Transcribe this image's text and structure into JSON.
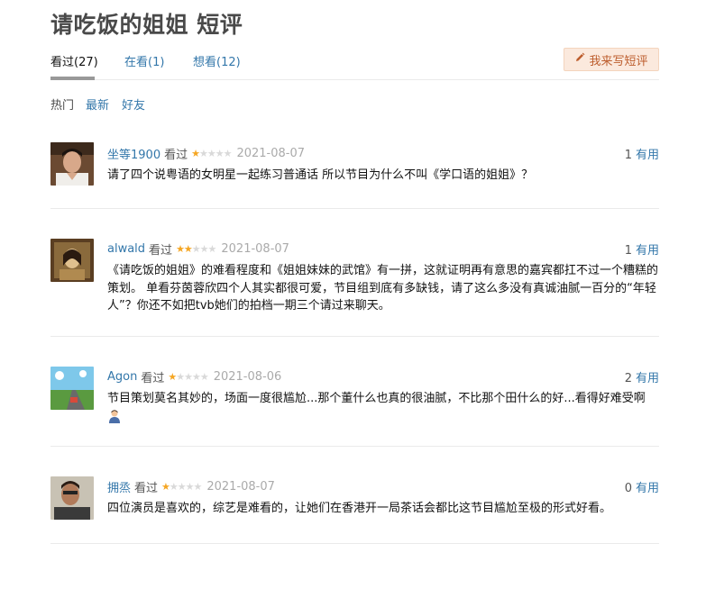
{
  "page": {
    "title": "请吃饭的姐姐 短评"
  },
  "tabs": [
    {
      "label": "看过(27)"
    },
    {
      "label": "在看(1)"
    },
    {
      "label": "想看(12)"
    }
  ],
  "write_button": {
    "label": "我来写短评",
    "icon": "pencil-icon"
  },
  "sorts": [
    {
      "label": "热门"
    },
    {
      "label": "最新"
    },
    {
      "label": "好友"
    }
  ],
  "comments": [
    {
      "user": "坐等1900",
      "status": "看过",
      "rating": 1,
      "date": "2021-08-07",
      "votes": "1",
      "vote_label": "有用",
      "text": "请了四个说粤语的女明星一起练习普通话 所以节目为什么不叫《学口语的姐姐》？"
    },
    {
      "user": "alwald",
      "status": "看过",
      "rating": 2,
      "date": "2021-08-07",
      "votes": "1",
      "vote_label": "有用",
      "text": "《请吃饭的姐姐》的难看程度和《姐姐妹妹的武馆》有一拼，这就证明再有意思的嘉宾都扛不过一个糟糕的策划。 单看芬茵蓉欣四个人其实都很可爱，节目组到底有多缺钱，请了这么多没有真诚油腻一百分的“年轻人”？你还不如把tvb她们的拍档一期三个请过来聊天。"
    },
    {
      "user": "Agon",
      "status": "看过",
      "rating": 1,
      "date": "2021-08-06",
      "votes": "2",
      "vote_label": "有用",
      "text": "节目策划莫名其妙的，场面一度很尴尬...那个董什么也真的很油腻，不比那个田什么的好...看得好难受啊"
    },
    {
      "user": "拥烝",
      "status": "看过",
      "rating": 1,
      "date": "2021-08-07",
      "votes": "0",
      "vote_label": "有用",
      "text": "四位演员是喜欢的，综艺是难看的，让她们在香港开一局茶话会都比这节目尴尬至极的形式好看。"
    }
  ],
  "colors": {
    "link": "#3377aa",
    "star": "#f5a623",
    "button_bg": "#fbe9dd",
    "button_text": "#bd5d2d"
  }
}
